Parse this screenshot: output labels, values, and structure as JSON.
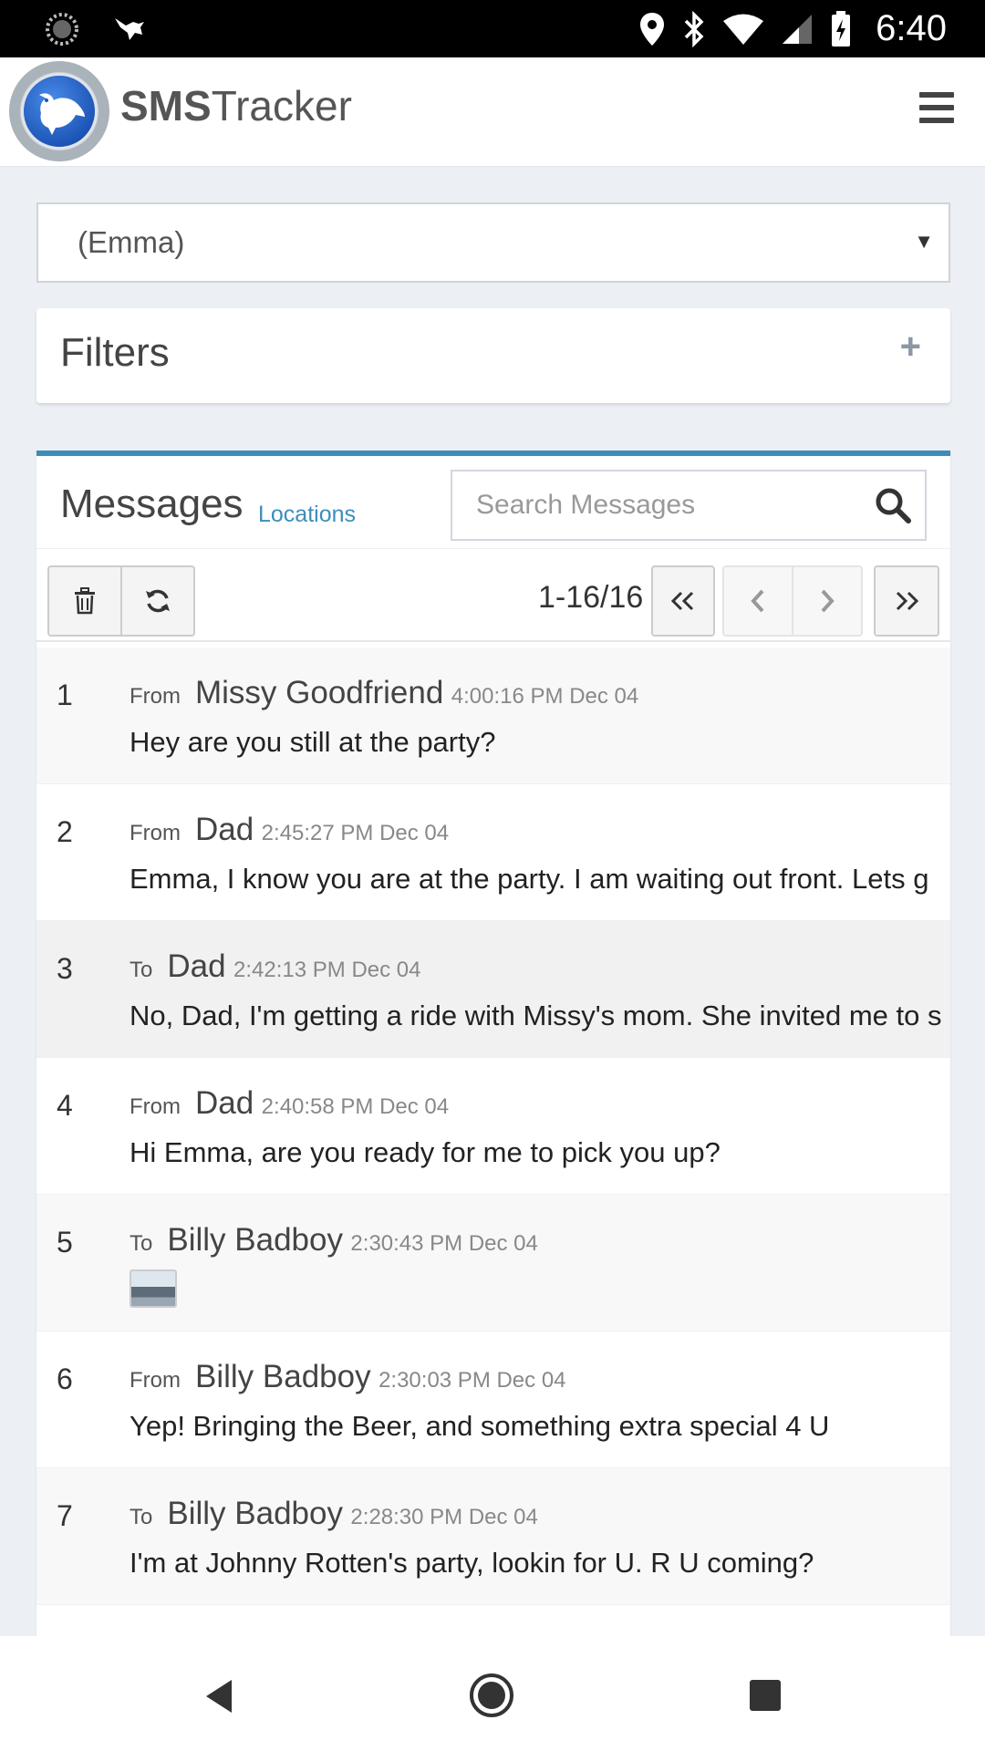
{
  "status_bar": {
    "time": "6:40"
  },
  "app": {
    "brand_bold": "SMS",
    "brand_rest": "Tracker"
  },
  "device_select": {
    "value": "(Emma)"
  },
  "filters": {
    "title": "Filters"
  },
  "messages": {
    "title": "Messages",
    "locations_link": "Locations",
    "search_placeholder": "Search Messages",
    "pager": "1-16/16",
    "rows": [
      {
        "num": "1",
        "dir": "From",
        "contact": "Missy Goodfriend",
        "time": "4:00:16 PM Dec 04",
        "text": "Hey are you still at the party?"
      },
      {
        "num": "2",
        "dir": "From",
        "contact": "Dad",
        "time": "2:45:27 PM Dec 04",
        "text": "Emma, I know you are at the party. I am waiting out front. Lets g"
      },
      {
        "num": "3",
        "dir": "To",
        "contact": "Dad",
        "time": "2:42:13 PM Dec 04",
        "text": "No, Dad, I'm getting a ride with Missy's mom. She invited me to s"
      },
      {
        "num": "4",
        "dir": "From",
        "contact": "Dad",
        "time": "2:40:58 PM Dec 04",
        "text": "Hi Emma, are you ready for me to pick you up?"
      },
      {
        "num": "5",
        "dir": "To",
        "contact": "Billy Badboy",
        "time": "2:30:43 PM Dec 04",
        "text": ""
      },
      {
        "num": "6",
        "dir": "From",
        "contact": "Billy Badboy",
        "time": "2:30:03 PM Dec 04",
        "text": "Yep! Bringing the Beer, and something extra special 4 U"
      },
      {
        "num": "7",
        "dir": "To",
        "contact": "Billy Badboy",
        "time": "2:28:30 PM Dec 04",
        "text": "I'm at Johnny Rotten's party, lookin for U. R U coming?"
      }
    ]
  },
  "colors": {
    "accent": "#3c8dbc",
    "background": "#ecf0f5"
  }
}
